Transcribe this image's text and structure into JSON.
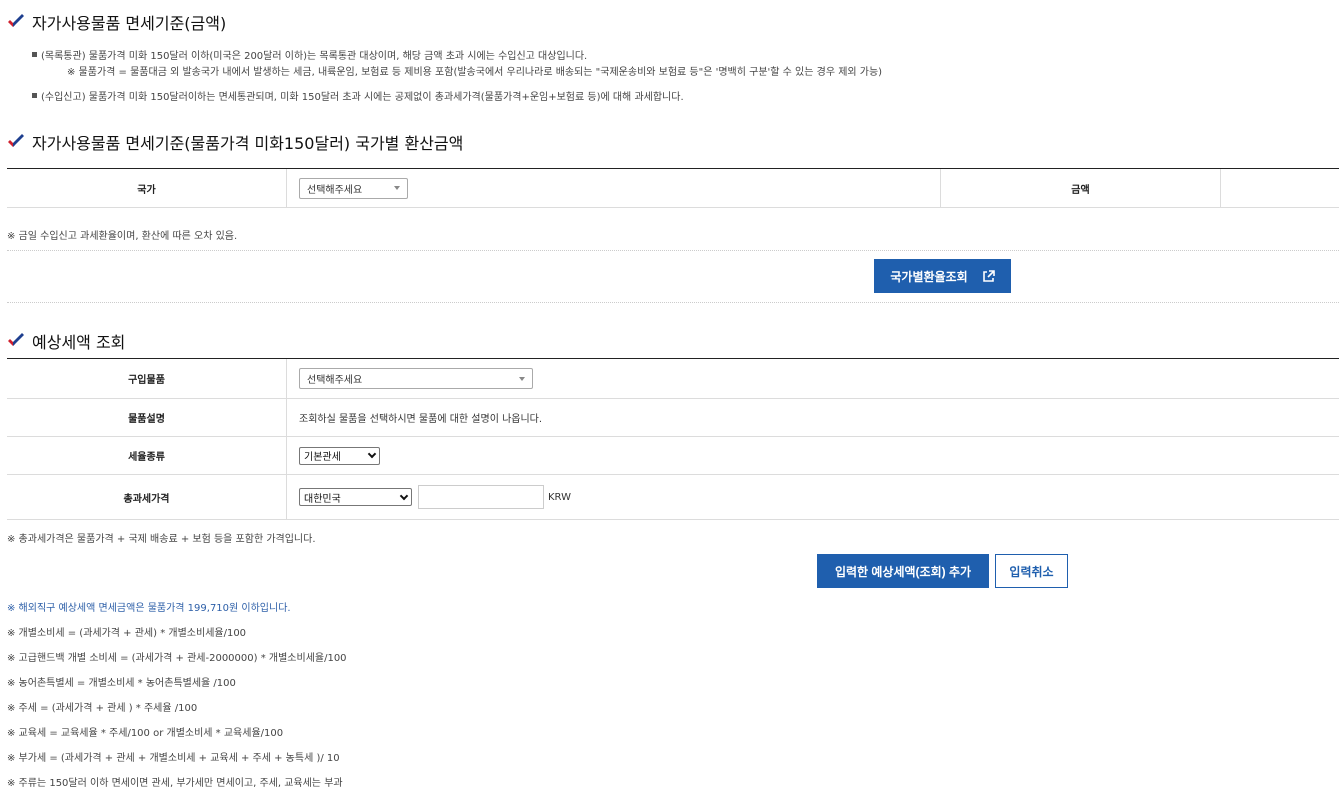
{
  "sections": {
    "s1_title": "자가사용물품 면세기준(금액)",
    "s1_bullets": [
      "(목록통관) 물품가격 미화 150달러 이하(미국은 200달러 이하)는 목록통관 대상이며, 해당 금액 초과 시에는 수입신고 대상입니다.",
      "(수입신고) 물품가격 미화 150달러이하는 면세통관되며, 미화 150달러 초과 시에는 공제없이 총과세가격(물품가격+운임+보험료 등)에 대해 과세합니다."
    ],
    "s1_subnote": "※ 물품가격 = 물품대금 외 발송국가 내에서 발생하는 세금, 내륙운임, 보험료 등 제비용 포함(발송국에서 우리나라로 배송되는 \"국제운송비와 보험료 등\"은 '명백히 구분'할 수 있는 경우 제외 가능)",
    "s2_title": "자가사용물품 면세기준(물품가격 미화150달러) 국가별 환산금액",
    "s3_title": "예상세액 조회"
  },
  "country_table": {
    "country_label": "국가",
    "country_select": "선택해주세요",
    "amount_label": "금액",
    "amount_value": ""
  },
  "exchange_note": "※  금일 수입신고 과세환율이며, 환산에 따른 오차 있음.",
  "exchange_button": "국가별환율조회",
  "tax_table": {
    "item_label": "구입물품",
    "item_select": "선택해주세요",
    "desc_label": "물품설명",
    "desc_value": "조회하실 물품을 선택하시면 물품에 대한 설명이 나옵니다.",
    "rate_label": "세율종류",
    "rate_select": "기본관세",
    "total_label": "총과세가격",
    "currency_select": "대한민국",
    "amount_input": "",
    "currency_unit": "KRW"
  },
  "total_note": "※  총과세가격은 물품가격 + 국제 배송료 + 보험 등을 포함한 가격입니다.",
  "add_button": "입력한 예상세액(조회) 추가",
  "cancel_button": "입력취소",
  "formula_notes": [
    "※  해외직구 예상세액 면세금액은 물품가격 199,710원 이하입니다.",
    "※  개별소비세 = (과세가격 + 관세) * 개별소비세율/100",
    "※  고급핸드백 개별 소비세 = (과세가격 + 관세-2000000) * 개별소비세율/100",
    "※  농어촌특별세 = 개별소비세 * 농어촌특별세율 /100",
    "※  주세 = (과세가격 + 관세 ) * 주세율 /100",
    "※  교육세 = 교육세율 * 주세/100 or 개별소비세 * 교육세율/100",
    "※  부가세 = (과세가격 + 관세 + 개별소비세 + 교육세 + 주세 + 농특세 )/ 10",
    "※  주류는 150달러 이하 면세이면 관세, 부가세만 면세이고, 주세, 교육세는 부과"
  ],
  "colors": {
    "accent": "#1f5fae",
    "check_blue": "#1e3f8f",
    "check_red": "#d0202e",
    "note_blue": "#2d5fa8"
  }
}
